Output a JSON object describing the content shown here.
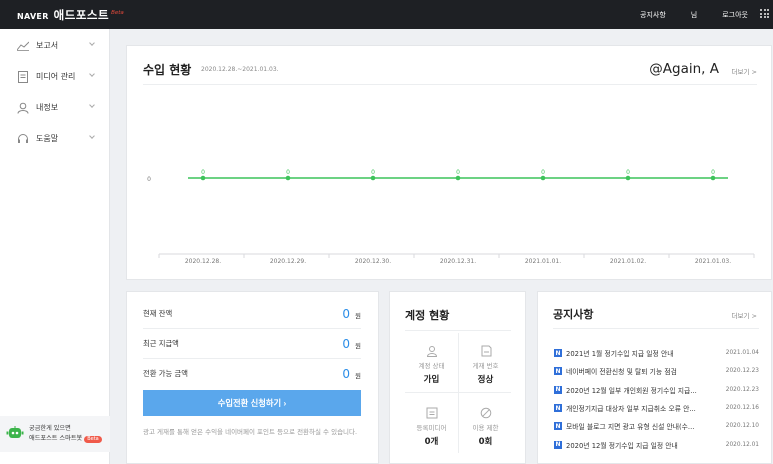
{
  "topbar": {
    "logo_naver": "NAVER",
    "logo_name": "애드포스트",
    "logo_beta": "Beta",
    "nav": [
      "공지사항",
      "님",
      "로그아웃"
    ]
  },
  "sidebar": {
    "items": [
      {
        "label": "보고서",
        "icon": "chart-line-icon",
        "has_chevron": true
      },
      {
        "label": "미디어 관리",
        "icon": "document-icon",
        "has_chevron": true
      },
      {
        "label": "내정보",
        "icon": "user-icon",
        "has_chevron": true
      },
      {
        "label": "도움말",
        "icon": "headset-icon",
        "has_chevron": true
      }
    ],
    "chatbot": {
      "line1": "궁금한게 있으면",
      "line2": "애드포스트 스마트봇",
      "beta": "Beta"
    }
  },
  "income": {
    "title": "수입 현황",
    "date_range": "2020.12.28.~2021.01.03.",
    "user": "@Again, A",
    "more": "더보기 >"
  },
  "chart_data": {
    "type": "line",
    "categories": [
      "2020.12.28.",
      "2020.12.29.",
      "2020.12.30.",
      "2020.12.31.",
      "2021.01.01.",
      "2021.01.02.",
      "2021.01.03."
    ],
    "series": [
      {
        "values": [
          0,
          0,
          0,
          0,
          0,
          0,
          0
        ]
      }
    ],
    "y_tick_labels": [
      "0"
    ],
    "data_labels": [
      "0",
      "0",
      "0",
      "0",
      "0",
      "0",
      "0"
    ],
    "color": "#3cc35a",
    "grid": false
  },
  "balance": {
    "rows": [
      {
        "label": "현재 잔액",
        "value": "0",
        "unit": "원"
      },
      {
        "label": "최근 지급액",
        "value": "0",
        "unit": "원"
      },
      {
        "label": "전환 가능 금액",
        "value": "0",
        "unit": "원"
      }
    ],
    "button": "수입전환 신청하기  ›",
    "note": "광고 게재를 통해 얻은 수익을 네이버페이 포인트 등으로 전환하실 수 있습니다."
  },
  "account": {
    "title": "계정 현황",
    "cells": [
      {
        "label": "계정 상태",
        "value": "가입",
        "icon": "user-outline-icon"
      },
      {
        "label": "게재 번호",
        "value": "정상",
        "icon": "tag-icon"
      },
      {
        "label": "등록미디어",
        "value": "0개",
        "icon": "media-icon"
      },
      {
        "label": "이용 제한",
        "value": "0회",
        "icon": "ban-icon"
      }
    ]
  },
  "notice": {
    "title": "공지사항",
    "more": "더보기 >",
    "badge": "N",
    "items": [
      {
        "text": "2021년 1월 정기수입 지급 일정 안내",
        "date": "2021.01.04"
      },
      {
        "text": "네이버페이 전환신청 및 탈퇴 기능 점검",
        "date": "2020.12.23"
      },
      {
        "text": "2020년 12월 일부 개인회원 정기수입 지급...",
        "date": "2020.12.23"
      },
      {
        "text": "개인정기지급 대상자 일부 지급취소 오류 안...",
        "date": "2020.12.16"
      },
      {
        "text": "모바일 블로그 지면 광고 유형 신설 안내(수...",
        "date": "2020.12.10"
      },
      {
        "text": "2020년 12월 정기수입 지급 일정 안내",
        "date": "2020.12.01"
      }
    ]
  },
  "colors": {
    "accent": "#5aa7ec",
    "value_blue": "#2b8de8",
    "topbar": "#1e2024",
    "notice_badge": "#2f6fd9",
    "line": "#3cc35a"
  }
}
